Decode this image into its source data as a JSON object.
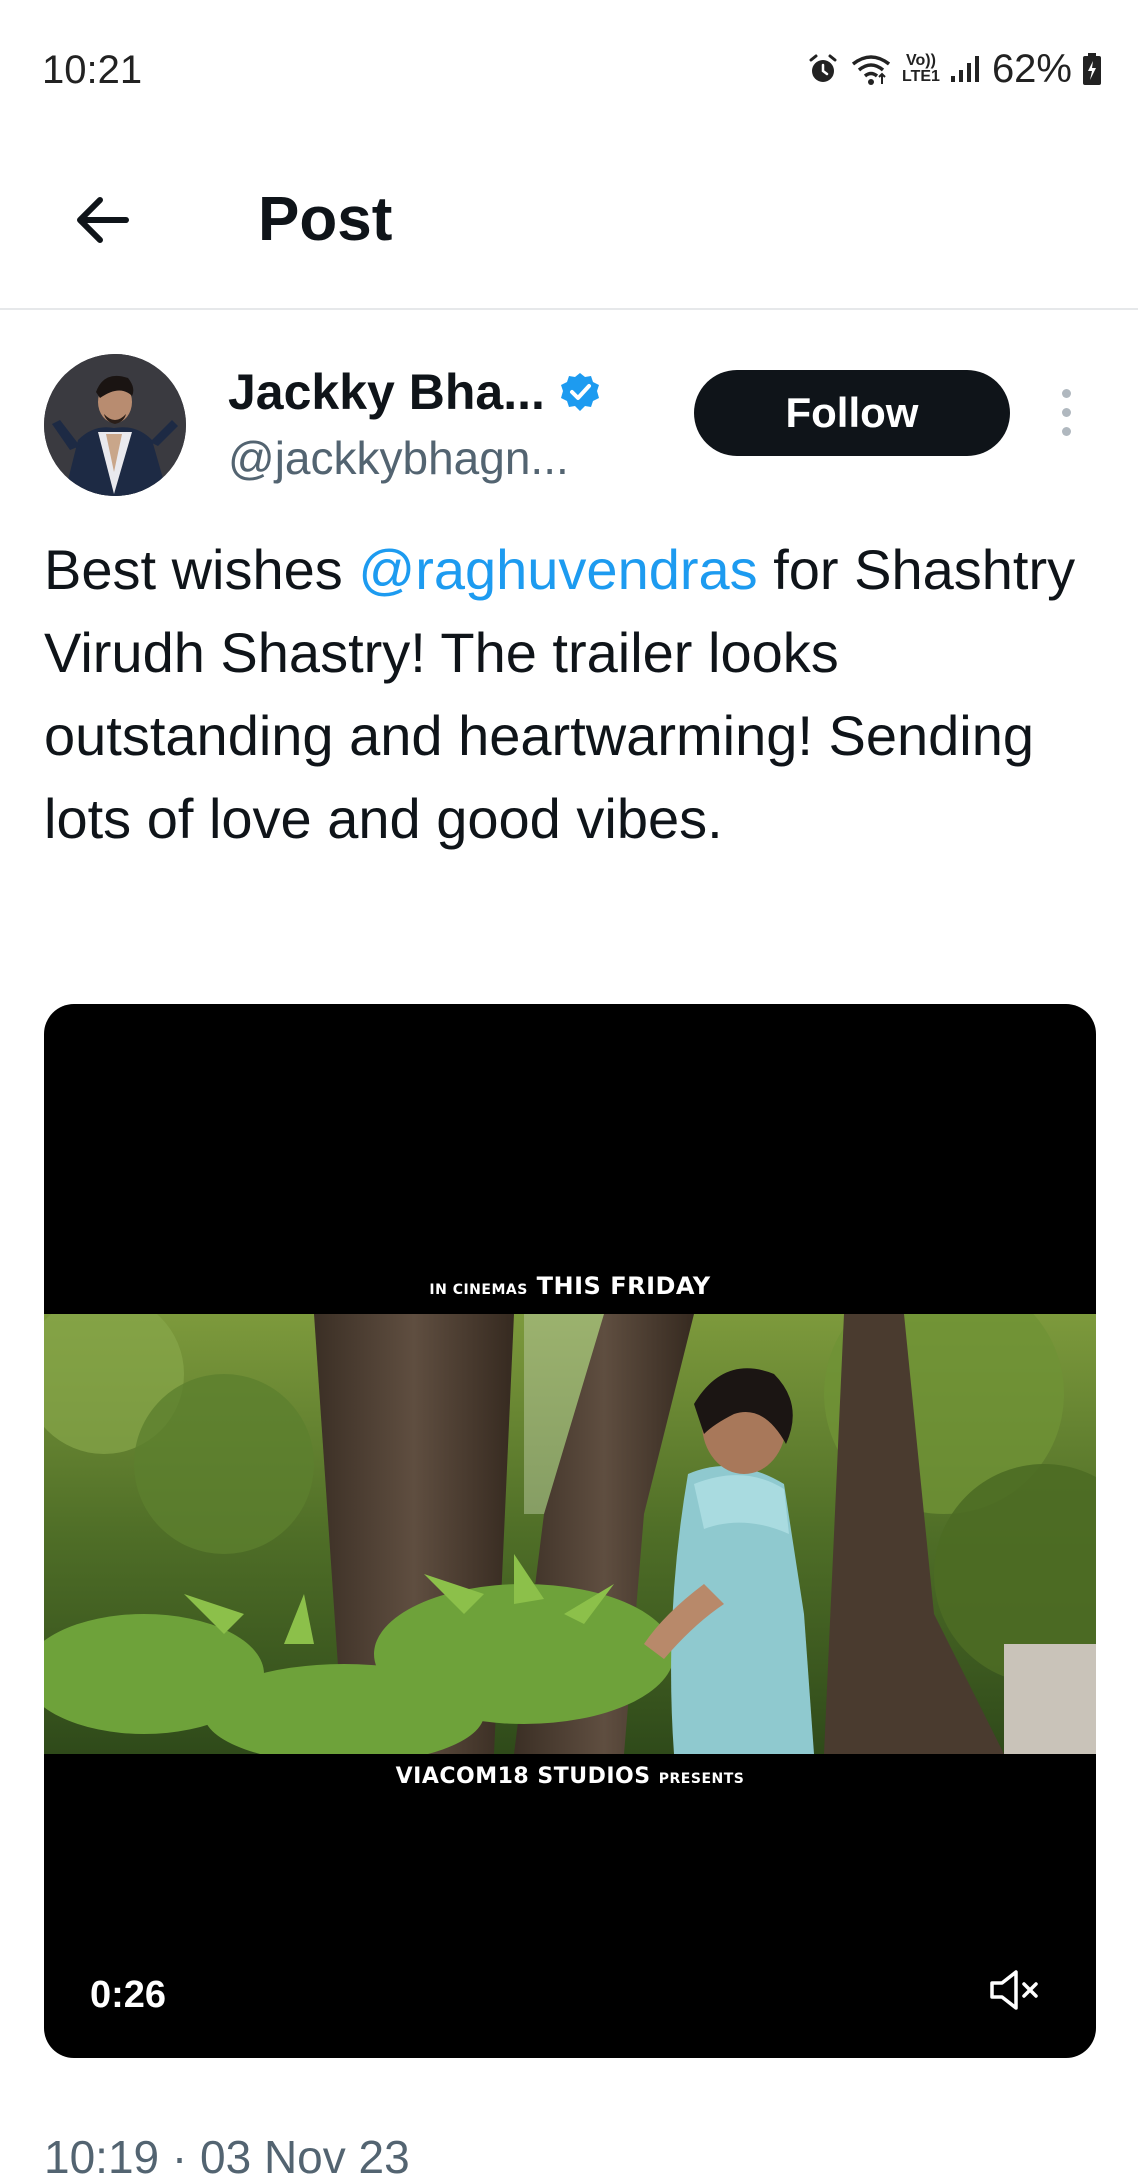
{
  "status_bar": {
    "time": "10:21",
    "network_label_top": "Vo))",
    "network_label_bottom": "LTE1",
    "battery_percent": "62%"
  },
  "header": {
    "title": "Post"
  },
  "author": {
    "display_name": "Jackky Bha...",
    "handle": "@jackkybhagn...",
    "verified": true,
    "follow_label": "Follow"
  },
  "tweet": {
    "text_before": "Best wishes ",
    "mention": "@raghuvendras",
    "text_after": " for Shashtry Virudh Shastry! The trailer looks outstanding and heartwarming! Sending lots of love and good vibes."
  },
  "media": {
    "caption_top_small": "IN CINEMAS",
    "caption_top_large": "THIS FRIDAY",
    "caption_bottom_large": "VIACOM18 STUDIOS",
    "caption_bottom_small": "PRESENTS",
    "duration": "0:26",
    "muted": true
  },
  "post_meta": {
    "timestamp": "10:19 · 03 Nov 23"
  },
  "colors": {
    "accent": "#1d9bf0",
    "text_primary": "#0f1419",
    "text_secondary": "#536471",
    "follow_button_bg": "#0f1419"
  },
  "icons": {
    "back": "arrow-left-icon",
    "verified": "verified-badge-icon",
    "more": "more-vertical-icon",
    "mute": "speaker-muted-icon",
    "alarm": "alarm-icon",
    "wifi": "wifi-icon",
    "signal": "signal-icon",
    "battery": "battery-charging-icon"
  }
}
